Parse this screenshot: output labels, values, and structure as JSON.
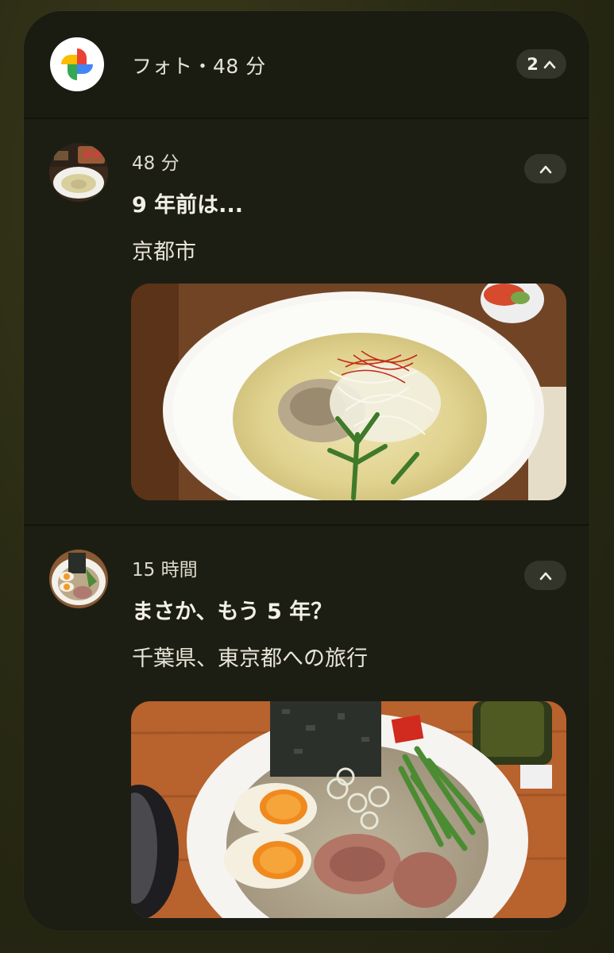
{
  "header": {
    "app_name_time": "フォト・48 分",
    "group_count": "2",
    "app_icon": "google-photos-pinwheel-icon",
    "expand_icon": "chevron-up-icon"
  },
  "notifications": [
    {
      "time": "48 分",
      "title": "9 年前は...",
      "subtitle": "京都市",
      "photo_desc_icon": "ramen-bowl-image"
    },
    {
      "time": "15 時間",
      "title": "まさか、もう 5 年？",
      "subtitle": "千葉県、東京都への旅行",
      "photo_desc_icon": "ramen-bowl-image"
    }
  ],
  "colors": {
    "card_bg": "#1d1e13",
    "pill_bg": "#34352a",
    "page_bg": "#2a2b14"
  }
}
